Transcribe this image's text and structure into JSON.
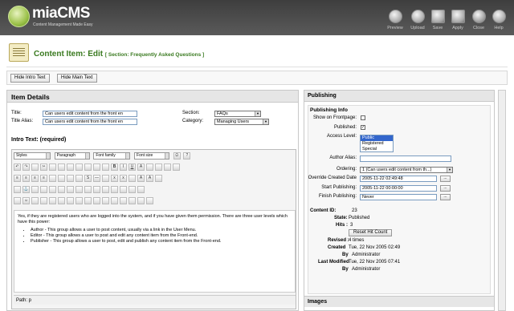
{
  "app": {
    "name": "miaCMS",
    "tagline": "Content Management Made Easy"
  },
  "toolbar": [
    {
      "label": "Preview",
      "icon": "preview-icon"
    },
    {
      "label": "Upload",
      "icon": "upload-icon"
    },
    {
      "label": "Save",
      "icon": "save-icon"
    },
    {
      "label": "Apply",
      "icon": "apply-icon"
    },
    {
      "label": "Close",
      "icon": "close-icon"
    },
    {
      "label": "Help",
      "icon": "help-icon"
    }
  ],
  "page": {
    "title": "Content Item: Edit",
    "section": "[ Section: Frequently Asked Questions ]"
  },
  "buttons": {
    "hide_intro": "Hide Intro Text",
    "hide_main": "Hide Main Text"
  },
  "details": {
    "heading": "Item Details",
    "title_label": "Title:",
    "title_value": "Can users edit content from the front en",
    "alias_label": "Title Alias:",
    "alias_value": "Can users edit content from the front en",
    "section_label": "Section:",
    "section_value": "FAQs",
    "category_label": "Category:",
    "category_value": "Managing Users"
  },
  "editor": {
    "intro_label": "Intro Text: (required)",
    "styles": "Styles",
    "format": "Paragraph",
    "font_family": "Font family",
    "font_size": "Font size",
    "text_para": "Yes, if they are registered users who are logged into the system, and if you have given them permission. There are three user levels which have this power:",
    "bullets": [
      "Author - This group allows a user to post content, usually via a link in the User Menu.",
      "Editor - This group allows a user to post and edit any content item from the Front-end.",
      "Publisher - This group allows a user to post, edit and publish any content item from the Front-end."
    ],
    "path": "Path: p"
  },
  "publishing": {
    "heading": "Publishing",
    "info_heading": "Publishing Info",
    "show_frontpage_label": "Show on Frontpage:",
    "published_label": "Published:",
    "published_checked": true,
    "access_label": "Access Level:",
    "access_options": [
      "Public",
      "Registered",
      "Special"
    ],
    "access_selected": "Public",
    "author_alias_label": "Author Alias:",
    "ordering_label": "Ordering:",
    "ordering_value": "1 (Can users edit content from th...)",
    "override_date_label": "Override Created Date",
    "override_date_value": "2005-11-22 02:49:48",
    "start_label": "Start Publishing:",
    "start_value": "2005-11-22 00:00:00",
    "finish_label": "Finish Publishing:",
    "finish_value": "Never",
    "content_id_label": "Content ID:",
    "content_id": "23",
    "state_label": "State:",
    "state": "Published",
    "hits_label": "Hits :",
    "hits": "3",
    "reset_hits": "Reset Hit Count",
    "revised_label": "Revised :",
    "revised": "4 times",
    "created_label": "Created",
    "created": "Tue, 22 Nov 2005 02:49",
    "created_by_label": "By",
    "created_by": "Administrator",
    "modified_label": "Last Modified",
    "modified": "Tue, 22 Nov 2005 07:41",
    "modified_by_label": "By",
    "modified_by": "Administrator",
    "images_heading": "Images"
  }
}
